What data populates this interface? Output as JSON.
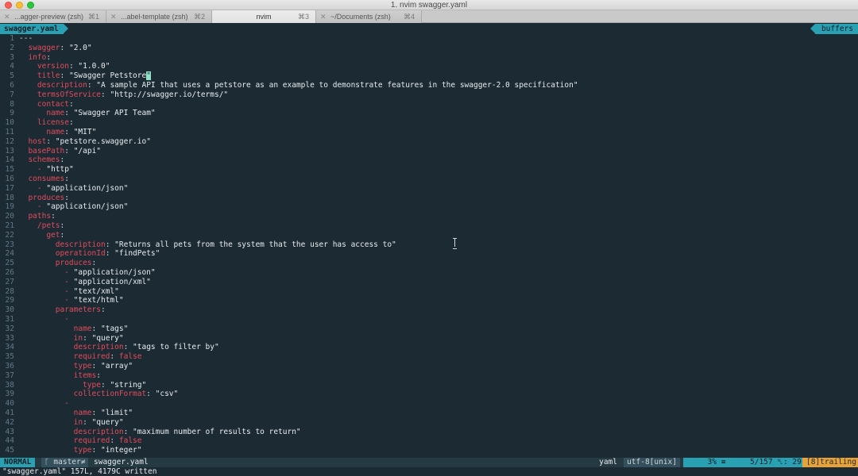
{
  "window": {
    "title": "1. nvim swagger.yaml"
  },
  "tabs": [
    {
      "label": "...agger-preview (zsh)",
      "shortcut": "⌘1",
      "active": false
    },
    {
      "label": "...abel-template (zsh)",
      "shortcut": "⌘2",
      "active": false
    },
    {
      "label": "nvim",
      "shortcut": "⌘3",
      "active": true
    },
    {
      "label": "~/Documents (zsh)",
      "shortcut": "⌘4",
      "active": false
    }
  ],
  "vim_tabline": {
    "active_tab": "swagger.yaml",
    "buffers_label": "buffers"
  },
  "editor": {
    "lines": [
      {
        "n": "1",
        "text": "---"
      },
      {
        "n": "2",
        "text": "  swagger: \"2.0\""
      },
      {
        "n": "3",
        "text": "  info:"
      },
      {
        "n": "4",
        "text": "    version: \"1.0.0\""
      },
      {
        "n": "5",
        "text": "    title: \"Swagger Petstore\""
      },
      {
        "n": "6",
        "text": "    description: \"A sample API that uses a petstore as an example to demonstrate features in the swagger-2.0 specification\""
      },
      {
        "n": "7",
        "text": "    termsOfService: \"http://swagger.io/terms/\""
      },
      {
        "n": "8",
        "text": "    contact:"
      },
      {
        "n": "9",
        "text": "      name: \"Swagger API Team\""
      },
      {
        "n": "10",
        "text": "    license:"
      },
      {
        "n": "11",
        "text": "      name: \"MIT\""
      },
      {
        "n": "12",
        "text": "  host: \"petstore.swagger.io\""
      },
      {
        "n": "13",
        "text": "  basePath: \"/api\""
      },
      {
        "n": "14",
        "text": "  schemes:"
      },
      {
        "n": "15",
        "text": "    - \"http\""
      },
      {
        "n": "16",
        "text": "  consumes:"
      },
      {
        "n": "17",
        "text": "    - \"application/json\""
      },
      {
        "n": "18",
        "text": "  produces:"
      },
      {
        "n": "19",
        "text": "    - \"application/json\""
      },
      {
        "n": "20",
        "text": "  paths:"
      },
      {
        "n": "21",
        "text": "    /pets:"
      },
      {
        "n": "22",
        "text": "      get:"
      },
      {
        "n": "23",
        "text": "        description: \"Returns all pets from the system that the user has access to\""
      },
      {
        "n": "24",
        "text": "        operationId: \"findPets\""
      },
      {
        "n": "25",
        "text": "        produces:"
      },
      {
        "n": "26",
        "text": "          - \"application/json\""
      },
      {
        "n": "27",
        "text": "          - \"application/xml\""
      },
      {
        "n": "28",
        "text": "          - \"text/xml\""
      },
      {
        "n": "29",
        "text": "          - \"text/html\""
      },
      {
        "n": "30",
        "text": "        parameters:"
      },
      {
        "n": "31",
        "text": "          -"
      },
      {
        "n": "32",
        "text": "            name: \"tags\""
      },
      {
        "n": "33",
        "text": "            in: \"query\""
      },
      {
        "n": "34",
        "text": "            description: \"tags to filter by\""
      },
      {
        "n": "35",
        "text": "            required: false"
      },
      {
        "n": "36",
        "text": "            type: \"array\""
      },
      {
        "n": "37",
        "text": "            items:"
      },
      {
        "n": "38",
        "text": "              type: \"string\""
      },
      {
        "n": "39",
        "text": "            collectionFormat: \"csv\""
      },
      {
        "n": "40",
        "text": "          -"
      },
      {
        "n": "41",
        "text": "            name: \"limit\""
      },
      {
        "n": "42",
        "text": "            in: \"query\""
      },
      {
        "n": "43",
        "text": "            description: \"maximum number of results to return\""
      },
      {
        "n": "44",
        "text": "            required: false"
      },
      {
        "n": "45",
        "text": "            type: \"integer\""
      }
    ],
    "cursor_line": "5",
    "cursor_char": "\""
  },
  "statusline": {
    "mode": "NORMAL",
    "branch": "master",
    "branch_icon": "git-branch-icon",
    "branch_suffix": "≠",
    "file": "swagger.yaml",
    "filetype": "yaml",
    "encoding": "utf-8[unix]",
    "percent": "3%",
    "percent_icon": "≡",
    "position": "5/157",
    "column": ": 29",
    "line_icon": "ln-icon",
    "warning": "[8]trailing"
  },
  "cmdline": {
    "message": "\"swagger.yaml\" 157L, 4179C written"
  },
  "colors": {
    "background": "#1c2b33",
    "key": "#e24b5b",
    "string": "#e7ecee",
    "accent": "#2aa1b3",
    "warning": "#e8a23a",
    "cursor": "#8fe3c4"
  }
}
